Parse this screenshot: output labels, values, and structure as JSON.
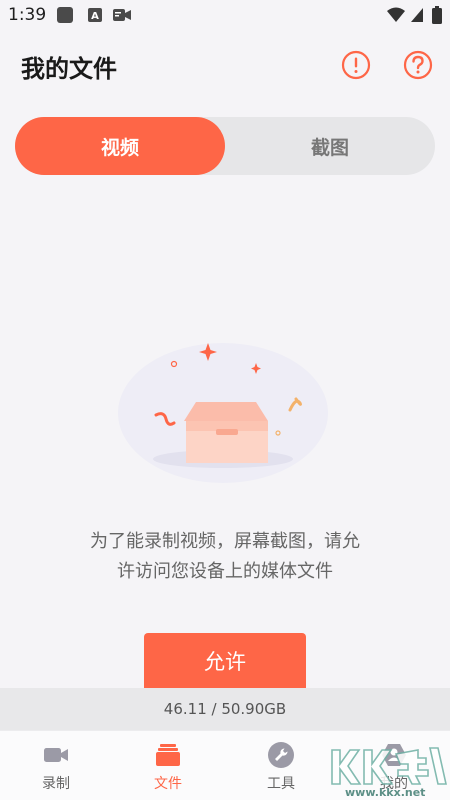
{
  "status_bar": {
    "time": "1:39"
  },
  "header": {
    "title": "我的文件",
    "info_icon": "exclamation-circle-icon",
    "help_icon": "question-circle-icon"
  },
  "segmented": {
    "tabs": [
      "视频",
      "截图"
    ],
    "selected": "视频"
  },
  "empty_state": {
    "message_line1": "为了能录制视频，屏幕截图，请允",
    "message_line2": "许访问您设备上的媒体文件",
    "allow_button": "允许"
  },
  "storage": {
    "text": "46.11 / 50.90GB"
  },
  "nav": {
    "items": [
      {
        "label": "录制",
        "icon": "video-camera-icon"
      },
      {
        "label": "文件",
        "icon": "folder-icon"
      },
      {
        "label": "工具",
        "icon": "wrench-icon"
      },
      {
        "label": "我的",
        "icon": "profile-icon"
      }
    ],
    "active": "文件"
  },
  "watermark": {
    "url": "www.kkx.net"
  },
  "colors": {
    "accent": "#fe6647",
    "background": "#f5f4f7",
    "inactive_tab": "#e6e6e8",
    "storage_bar": "#e8e8ea"
  }
}
